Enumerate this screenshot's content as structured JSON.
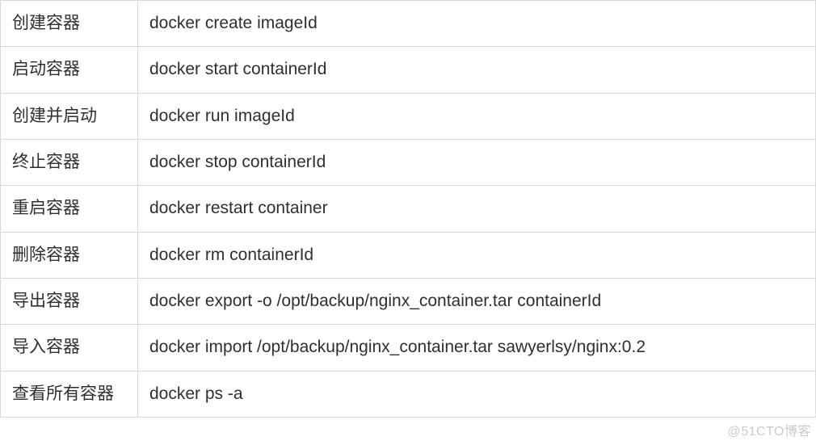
{
  "rows": [
    {
      "label": "创建容器",
      "command": "docker create imageId"
    },
    {
      "label": "启动容器",
      "command": "docker start containerId"
    },
    {
      "label": "创建并启动",
      "command": "docker run imageId"
    },
    {
      "label": "终止容器",
      "command": "docker stop containerId"
    },
    {
      "label": "重启容器",
      "command": "docker restart container"
    },
    {
      "label": "删除容器",
      "command": "docker rm containerId"
    },
    {
      "label": "导出容器",
      "command": "docker export -o /opt/backup/nginx_container.tar containerId"
    },
    {
      "label": "导入容器",
      "command": "docker import /opt/backup/nginx_container.tar sawyerlsy/nginx:0.2"
    },
    {
      "label": "查看所有容器",
      "command": "docker ps -a"
    }
  ],
  "watermark": "@51CTO博客"
}
